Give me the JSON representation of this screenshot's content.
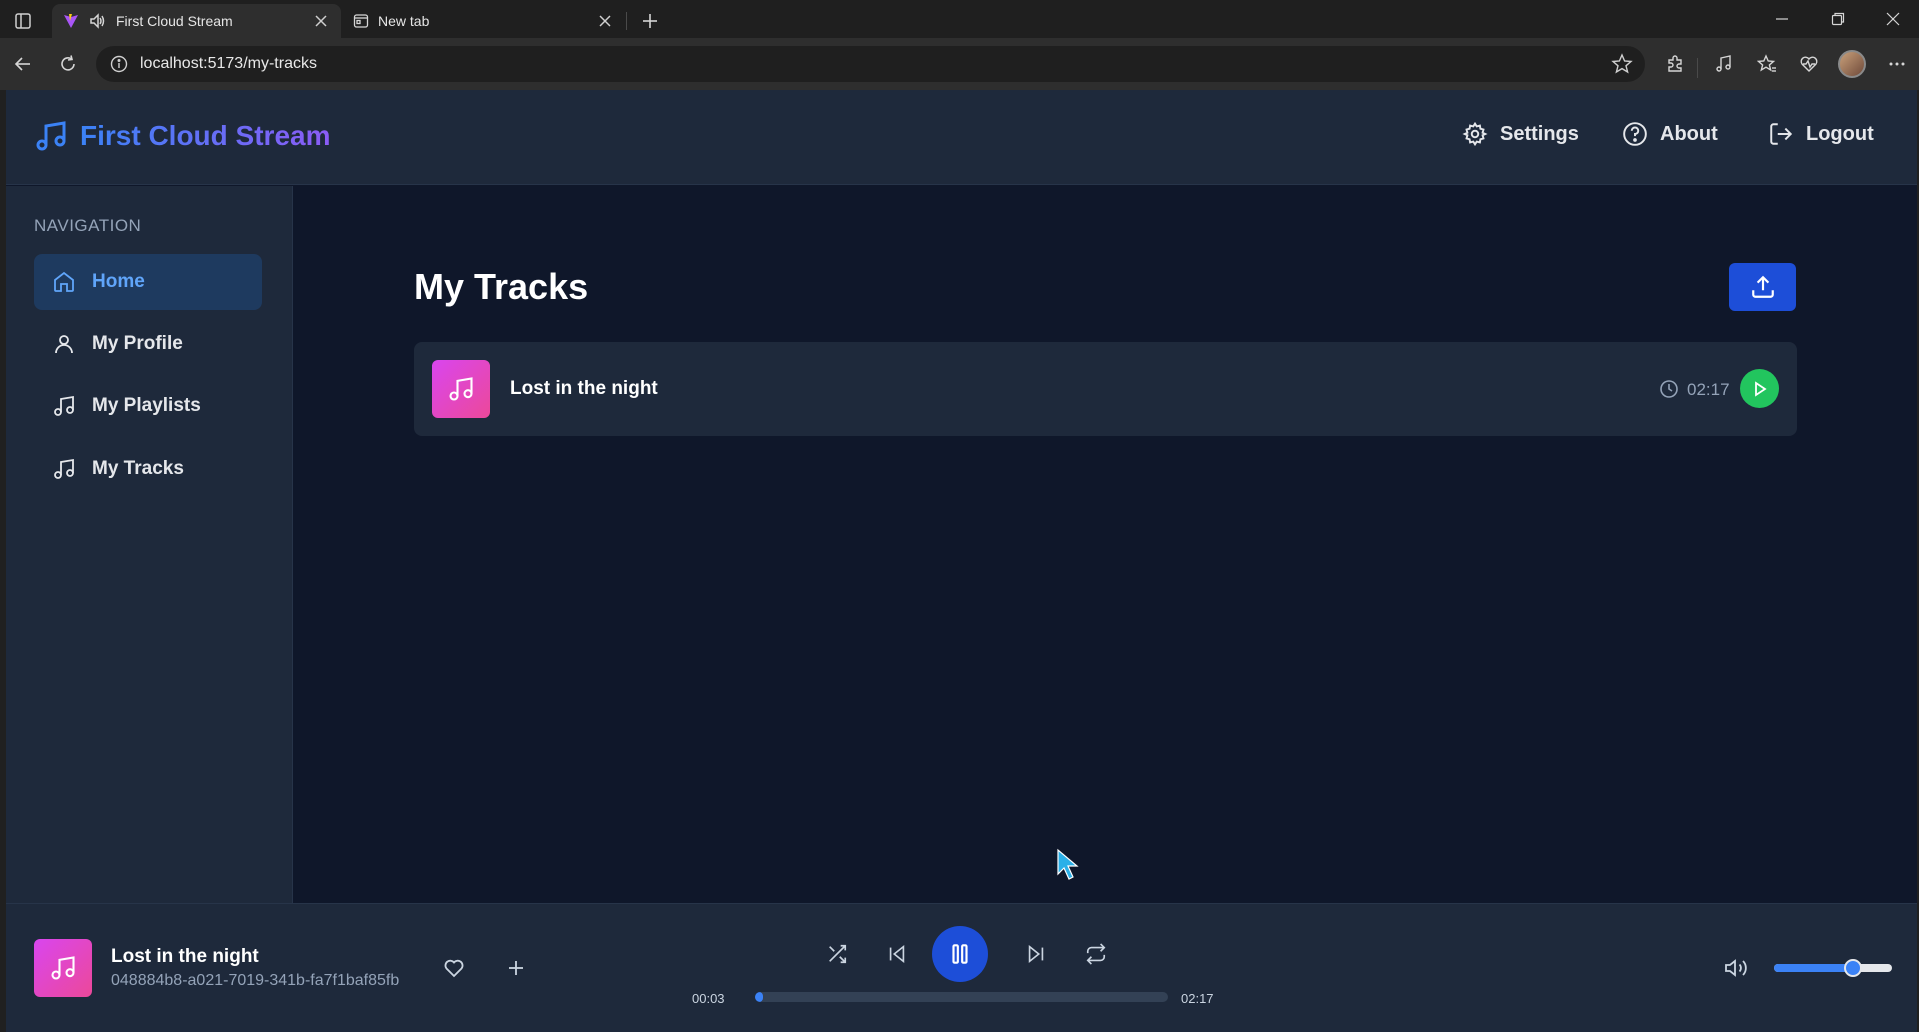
{
  "browser": {
    "tabs": [
      {
        "title": "First Cloud Stream",
        "active": true,
        "playing_audio": true
      },
      {
        "title": "New tab",
        "active": false
      }
    ],
    "address": {
      "url": "localhost:5173/my-tracks"
    }
  },
  "app": {
    "brand": "First Cloud Stream",
    "header_links": {
      "settings": "Settings",
      "about": "About",
      "logout": "Logout"
    },
    "sidebar": {
      "heading": "NAVIGATION",
      "items": [
        {
          "label": "Home",
          "icon": "home-icon",
          "active": true
        },
        {
          "label": "My Profile",
          "icon": "user-icon",
          "active": false
        },
        {
          "label": "My Playlists",
          "icon": "music-note-icon",
          "active": false
        },
        {
          "label": "My Tracks",
          "icon": "music-note-icon",
          "active": false
        }
      ]
    },
    "main": {
      "title": "My Tracks",
      "tracks": [
        {
          "title": "Lost in the night",
          "duration": "02:17"
        }
      ]
    },
    "player": {
      "title": "Lost in the night",
      "track_id": "048884b8-a021-7019-341b-fa7f1baf85fb",
      "current_time": "00:03",
      "total_time": "02:17",
      "progress": 0.02,
      "volume": 0.67,
      "state": "playing"
    },
    "colors": {
      "background": "#0f172a",
      "panel": "#1e293b",
      "accent": "#1d4ed8",
      "play_green": "#22c55e",
      "art_gradient_start": "#d946ef",
      "art_gradient_end": "#ec4899"
    }
  }
}
